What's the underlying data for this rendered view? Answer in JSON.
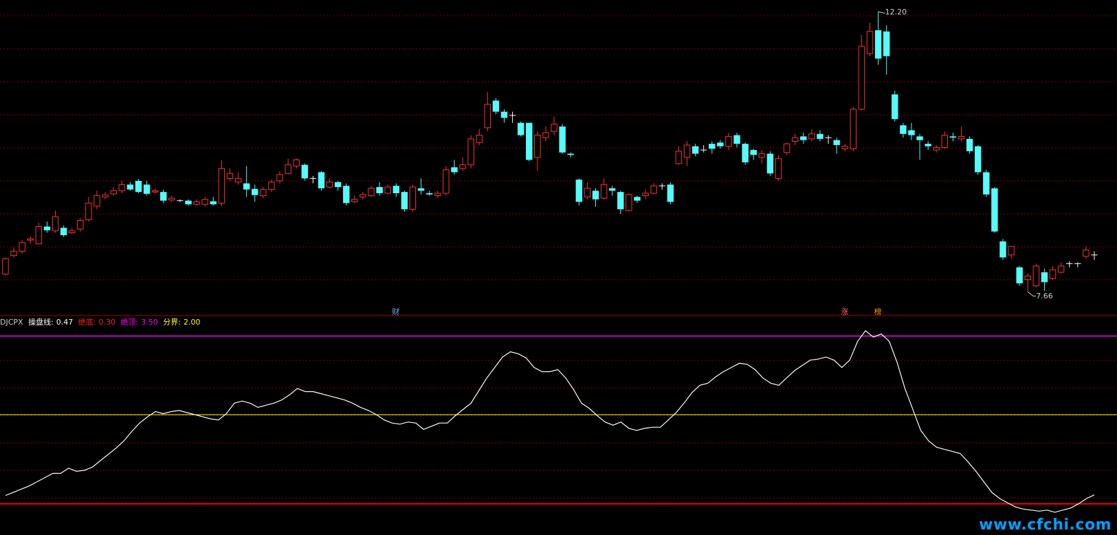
{
  "colors": {
    "up": "#ff3232",
    "down": "#54fcfc",
    "flat": "#ffffff",
    "grid": "#8b0000",
    "line": "#ffffff",
    "top_line": "#ff00ff",
    "divide_line": "#ffff00",
    "bottom_line": "#ff0000"
  },
  "indicator": {
    "name": "DJCPX",
    "caopan_label": "操盘线:",
    "caopan_value": "0.47",
    "juedi_label": "绝底:",
    "juedi_value": "0.30",
    "jueding_label": "绝顶:",
    "jueding_value": "3.50",
    "fenjie_label": "分界:",
    "fenjie_value": "2.00"
  },
  "events": [
    {
      "text": "财",
      "color": "#6aa8ff",
      "x": 47
    },
    {
      "text": "涨",
      "color": "#ff6060",
      "x": 101
    },
    {
      "text": "榜",
      "color": "#ff9900",
      "x": 105
    }
  ],
  "watermark": "www.cfchi.com",
  "chart_data": [
    {
      "type": "candlestick",
      "price_high_label": "12.20",
      "price_low_label": "7.66",
      "ylim": [
        7.4,
        12.3
      ],
      "candles": [
        [
          7.95,
          8.2,
          8.22,
          7.93
        ],
        [
          8.25,
          8.32,
          8.38,
          8.22
        ],
        [
          8.32,
          8.46,
          8.5,
          8.28
        ],
        [
          8.5,
          8.52,
          8.56,
          8.44
        ],
        [
          8.44,
          8.72,
          8.78,
          8.44
        ],
        [
          8.72,
          8.66,
          8.8,
          8.62
        ],
        [
          8.65,
          8.88,
          8.98,
          8.62
        ],
        [
          8.7,
          8.58,
          8.74,
          8.55
        ],
        [
          8.62,
          8.65,
          8.7,
          8.6
        ],
        [
          8.68,
          8.82,
          8.86,
          8.64
        ],
        [
          8.83,
          9.1,
          9.2,
          8.8
        ],
        [
          9.05,
          9.22,
          9.3,
          9.0
        ],
        [
          9.2,
          9.23,
          9.28,
          9.16
        ],
        [
          9.25,
          9.3,
          9.36,
          9.22
        ],
        [
          9.3,
          9.4,
          9.46,
          9.26
        ],
        [
          9.4,
          9.32,
          9.44,
          9.3
        ],
        [
          9.46,
          9.28,
          9.49,
          9.26
        ],
        [
          9.4,
          9.25,
          9.46,
          9.22
        ],
        [
          9.28,
          9.3,
          9.34,
          9.26
        ],
        [
          9.28,
          9.14,
          9.32,
          9.1
        ],
        [
          9.15,
          9.18,
          9.22,
          9.12
        ],
        [
          9.14,
          9.14,
          9.16,
          9.12
        ],
        [
          9.14,
          9.08,
          9.16,
          9.06
        ],
        [
          9.08,
          9.12,
          9.16,
          9.06
        ],
        [
          9.08,
          9.16,
          9.2,
          9.04
        ],
        [
          9.13,
          9.08,
          9.2,
          9.06
        ],
        [
          9.1,
          9.66,
          9.79,
          9.05
        ],
        [
          9.5,
          9.58,
          9.66,
          9.46
        ],
        [
          9.44,
          9.5,
          9.6,
          9.4
        ],
        [
          9.42,
          9.32,
          9.7,
          9.2
        ],
        [
          9.33,
          9.23,
          9.4,
          9.12
        ],
        [
          9.22,
          9.32,
          9.36,
          9.18
        ],
        [
          9.32,
          9.44,
          9.48,
          9.28
        ],
        [
          9.46,
          9.56,
          9.62,
          9.42
        ],
        [
          9.58,
          9.72,
          9.82,
          9.56
        ],
        [
          9.7,
          9.8,
          9.82,
          9.66
        ],
        [
          9.72,
          9.5,
          9.74,
          9.46
        ],
        [
          9.5,
          9.5,
          9.54,
          9.42
        ],
        [
          9.6,
          9.34,
          9.62,
          9.3
        ],
        [
          9.36,
          9.44,
          9.5,
          9.34
        ],
        [
          9.44,
          9.36,
          9.46,
          9.3
        ],
        [
          9.38,
          9.1,
          9.42,
          9.06
        ],
        [
          9.12,
          9.16,
          9.22,
          9.1
        ],
        [
          9.2,
          9.24,
          9.28,
          9.16
        ],
        [
          9.22,
          9.34,
          9.38,
          9.2
        ],
        [
          9.36,
          9.26,
          9.44,
          9.22
        ],
        [
          9.26,
          9.36,
          9.4,
          9.24
        ],
        [
          9.38,
          9.26,
          9.42,
          9.2
        ],
        [
          9.28,
          9.0,
          9.3,
          8.96
        ],
        [
          9.0,
          9.36,
          9.4,
          8.96
        ],
        [
          9.34,
          9.3,
          9.5,
          9.24
        ],
        [
          9.26,
          9.24,
          9.3,
          9.22
        ],
        [
          9.22,
          9.26,
          9.3,
          9.18
        ],
        [
          9.26,
          9.64,
          9.7,
          9.22
        ],
        [
          9.68,
          9.6,
          9.8,
          9.56
        ],
        [
          9.66,
          9.72,
          9.84,
          9.62
        ],
        [
          9.72,
          10.14,
          10.2,
          9.66
        ],
        [
          10.08,
          10.2,
          10.3,
          10.04
        ],
        [
          10.32,
          10.7,
          10.9,
          10.26
        ],
        [
          10.76,
          10.58,
          10.8,
          10.54
        ],
        [
          10.58,
          10.48,
          10.62,
          10.4
        ],
        [
          10.52,
          10.52,
          10.58,
          10.4
        ],
        [
          10.4,
          10.2,
          10.42,
          10.18
        ],
        [
          10.4,
          9.8,
          10.4,
          9.78
        ],
        [
          9.84,
          10.2,
          10.26,
          9.62
        ],
        [
          10.16,
          10.24,
          10.34,
          10.1
        ],
        [
          10.26,
          10.38,
          10.5,
          10.2
        ],
        [
          10.34,
          9.92,
          10.38,
          9.9
        ],
        [
          9.9,
          9.88,
          9.92,
          9.84
        ],
        [
          9.48,
          9.12,
          9.5,
          9.06
        ],
        [
          9.2,
          9.34,
          9.44,
          9.16
        ],
        [
          9.3,
          9.16,
          9.34,
          9.04
        ],
        [
          9.18,
          9.4,
          9.5,
          9.16
        ],
        [
          9.34,
          9.3,
          9.38,
          9.22
        ],
        [
          9.28,
          9.0,
          9.3,
          8.92
        ],
        [
          8.98,
          9.24,
          9.26,
          8.96
        ],
        [
          9.2,
          9.14,
          9.22,
          9.1
        ],
        [
          9.22,
          9.26,
          9.32,
          9.16
        ],
        [
          9.26,
          9.38,
          9.42,
          9.24
        ],
        [
          9.38,
          9.38,
          9.42,
          9.32
        ],
        [
          9.4,
          9.12,
          9.44,
          9.08
        ],
        [
          9.74,
          9.94,
          10.02,
          9.72
        ],
        [
          9.84,
          10.04,
          10.1,
          9.7
        ],
        [
          10.02,
          9.9,
          10.06,
          9.86
        ],
        [
          9.96,
          9.96,
          10.04,
          9.92
        ],
        [
          10.06,
          9.98,
          10.1,
          9.9
        ],
        [
          10.08,
          10.02,
          10.12,
          9.98
        ],
        [
          10.02,
          10.18,
          10.24,
          9.96
        ],
        [
          10.2,
          10.06,
          10.24,
          10.0
        ],
        [
          10.06,
          9.76,
          10.08,
          9.72
        ],
        [
          9.96,
          9.88,
          9.98,
          9.8
        ],
        [
          9.84,
          9.9,
          9.96,
          9.74
        ],
        [
          9.9,
          9.58,
          9.94,
          9.54
        ],
        [
          9.5,
          9.82,
          9.88,
          9.46
        ],
        [
          9.92,
          10.06,
          10.08,
          9.88
        ],
        [
          10.1,
          10.16,
          10.22,
          10.04
        ],
        [
          10.18,
          10.12,
          10.24,
          10.06
        ],
        [
          10.14,
          10.22,
          10.3,
          10.1
        ],
        [
          10.22,
          10.14,
          10.28,
          10.1
        ],
        [
          10.16,
          10.16,
          10.2,
          10.06
        ],
        [
          10.12,
          10.04,
          10.16,
          9.9
        ],
        [
          9.98,
          10.02,
          10.06,
          9.94
        ],
        [
          9.98,
          10.62,
          10.66,
          9.94
        ],
        [
          10.62,
          11.64,
          11.82,
          10.6
        ],
        [
          11.52,
          11.88,
          12.02,
          11.48
        ],
        [
          11.9,
          11.44,
          12.2,
          11.34
        ],
        [
          11.88,
          11.48,
          11.98,
          11.18
        ],
        [
          10.86,
          10.46,
          10.92,
          10.42
        ],
        [
          10.36,
          10.22,
          10.4,
          10.16
        ],
        [
          10.28,
          10.2,
          10.4,
          10.12
        ],
        [
          10.18,
          10.12,
          10.22,
          9.8
        ],
        [
          10.06,
          10.02,
          10.1,
          9.96
        ],
        [
          9.96,
          10.0,
          10.04,
          9.92
        ],
        [
          10.0,
          10.2,
          10.26,
          9.98
        ],
        [
          10.18,
          10.16,
          10.24,
          10.1
        ],
        [
          10.14,
          10.18,
          10.34,
          10.1
        ],
        [
          10.14,
          9.94,
          10.18,
          9.9
        ],
        [
          10.02,
          9.6,
          10.04,
          9.56
        ],
        [
          9.6,
          9.24,
          9.64,
          9.2
        ],
        [
          9.34,
          8.64,
          9.36,
          8.62
        ],
        [
          8.48,
          8.22,
          8.52,
          8.18
        ],
        [
          8.26,
          8.4,
          8.4,
          8.2
        ],
        [
          8.06,
          7.8,
          8.08,
          7.76
        ],
        [
          7.86,
          7.92,
          7.96,
          7.66
        ],
        [
          7.76,
          8.08,
          8.12,
          7.74
        ],
        [
          7.98,
          7.82,
          8.04,
          7.68
        ],
        [
          7.88,
          8.02,
          8.08,
          7.86
        ],
        [
          7.98,
          8.08,
          8.14,
          7.96
        ],
        [
          8.12,
          8.12,
          8.16,
          8.06
        ],
        [
          8.12,
          8.12,
          8.14,
          8.06
        ],
        [
          8.24,
          8.34,
          8.4,
          8.2
        ],
        [
          8.26,
          8.26,
          8.32,
          8.18
        ]
      ],
      "candle_order": "open, close, high, low"
    },
    {
      "type": "line",
      "series": [
        {
          "name": "操盘线",
          "values": [
            0.46,
            0.52,
            0.58,
            0.64,
            0.72,
            0.8,
            0.88,
            0.88,
            0.98,
            0.92,
            0.94,
            1.0,
            1.12,
            1.24,
            1.36,
            1.5,
            1.68,
            1.84,
            1.96,
            2.06,
            2.02,
            2.06,
            2.08,
            2.04,
            2.0,
            1.96,
            1.92,
            1.9,
            2.02,
            2.22,
            2.26,
            2.22,
            2.14,
            2.18,
            2.22,
            2.28,
            2.38,
            2.5,
            2.44,
            2.44,
            2.4,
            2.36,
            2.32,
            2.28,
            2.22,
            2.14,
            2.08,
            2.0,
            1.9,
            1.84,
            1.82,
            1.86,
            1.84,
            1.72,
            1.78,
            1.84,
            1.84,
            1.98,
            2.1,
            2.22,
            2.46,
            2.7,
            2.9,
            3.1,
            3.2,
            3.16,
            3.08,
            2.9,
            2.82,
            2.82,
            2.86,
            2.7,
            2.48,
            2.22,
            2.12,
            1.98,
            1.86,
            1.8,
            1.86,
            1.74,
            1.7,
            1.74,
            1.76,
            1.76,
            1.9,
            2.04,
            2.22,
            2.42,
            2.56,
            2.6,
            2.72,
            2.82,
            2.9,
            2.98,
            2.96,
            2.86,
            2.7,
            2.6,
            2.56,
            2.7,
            2.84,
            2.94,
            3.04,
            3.06,
            3.1,
            3.04,
            2.9,
            3.04,
            3.4,
            3.6,
            3.48,
            3.54,
            3.4,
            3.0,
            2.5,
            2.1,
            1.7,
            1.5,
            1.38,
            1.34,
            1.3,
            1.26,
            1.1,
            0.92,
            0.72,
            0.52,
            0.4,
            0.32,
            0.24,
            0.2,
            0.18,
            0.16,
            0.18,
            0.14,
            0.18,
            0.22,
            0.3,
            0.4,
            0.47
          ]
        }
      ],
      "reference_lines": {
        "绝顶": 3.5,
        "分界": 2.0,
        "绝底": 0.3
      },
      "ylim": [
        0.02,
        3.64
      ]
    }
  ]
}
